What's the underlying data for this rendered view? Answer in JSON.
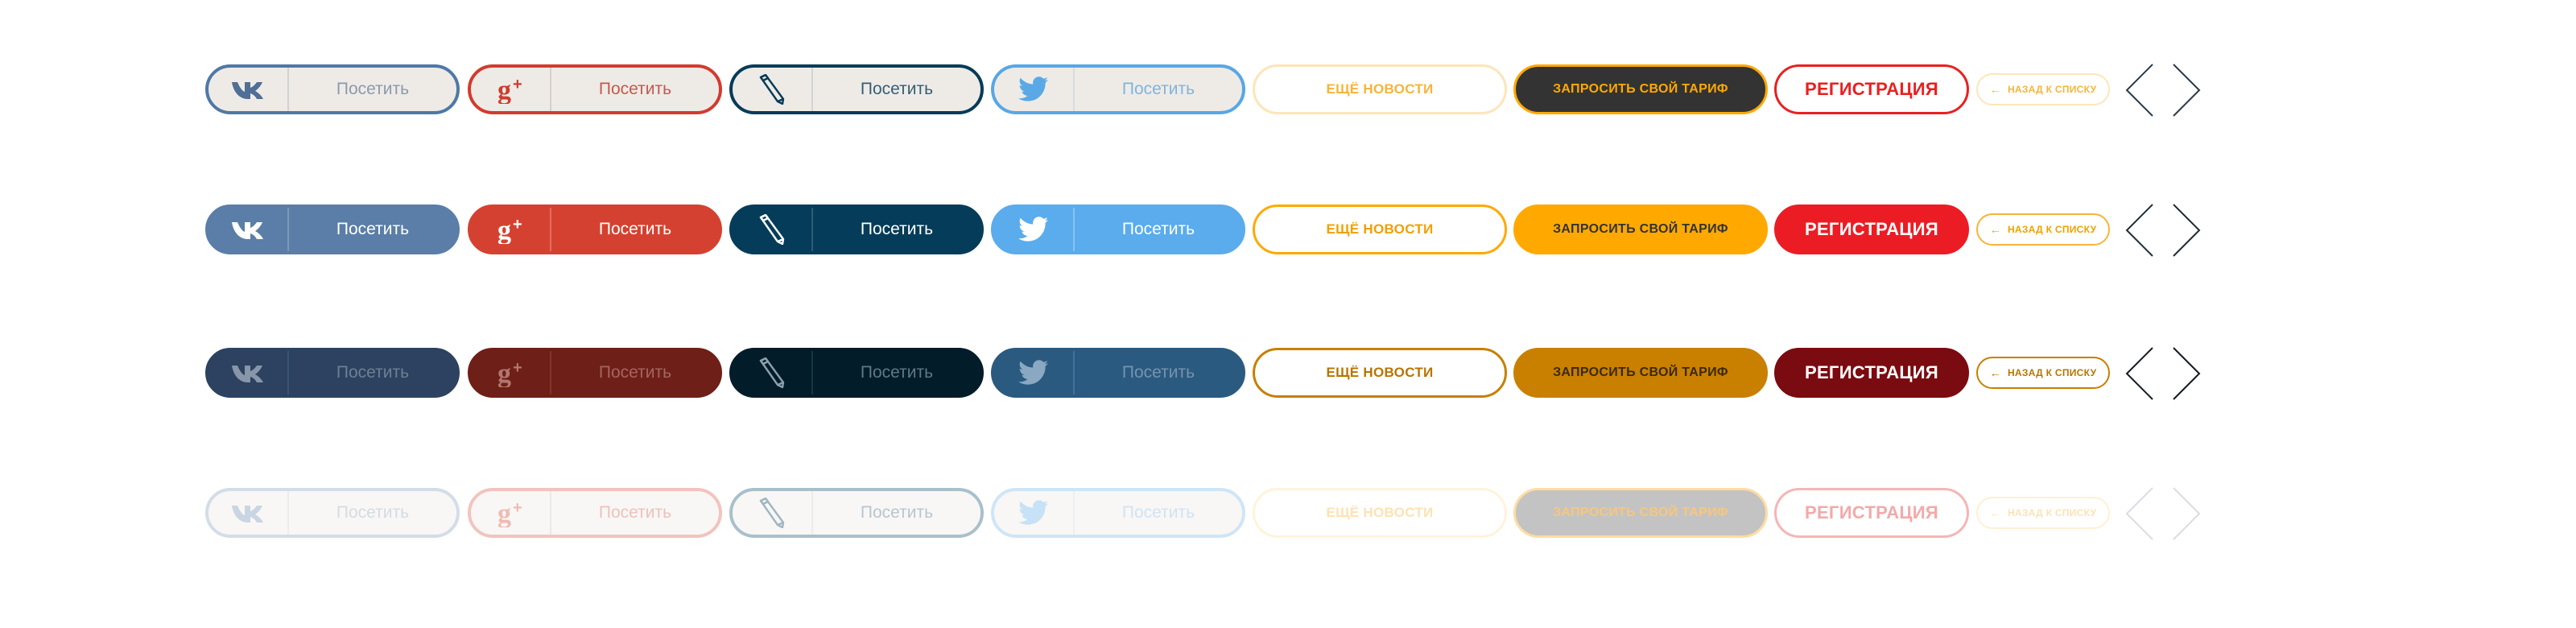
{
  "buttons": {
    "visit_label": "Посетить",
    "news_label": "ЕЩЁ НОВОСТИ",
    "tariff_label": "ЗАПРОСИТЬ СВОЙ ТАРИФ",
    "register_label": "РЕГИСТРАЦИЯ",
    "back_label": "НАЗАД К СПИСКУ",
    "back_arrow": "←"
  },
  "icons": {
    "vk": "vk-logo-icon",
    "google_plus": "google-plus-logo-icon",
    "livejournal": "livejournal-pencil-icon",
    "twitter": "twitter-bird-icon",
    "prev": "chevron-left-icon",
    "next": "chevron-right-icon"
  },
  "colors": {
    "vk": "#5a7ea7",
    "google_plus": "#d54130",
    "livejournal": "#053c59",
    "twitter": "#5aacec",
    "accent_orange": "#ffa900",
    "register_red": "#ec1c24",
    "dark": "#333333"
  },
  "arrow_colors": [
    "#2a3a48",
    "#1f2c36",
    "#111a22",
    "#d9dde2"
  ]
}
